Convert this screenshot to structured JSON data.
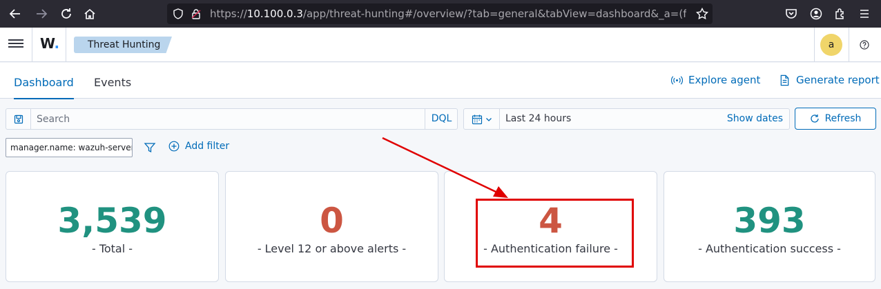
{
  "browser": {
    "url_prefix": "https://",
    "url_host": "10.100.0.3",
    "url_path": "/app/threat-hunting#/overview/?tab=general&tabView=dashboard&_a=(filters:!(),qu"
  },
  "header": {
    "logo": "W",
    "breadcrumb": "Threat Hunting",
    "avatar_letter": "a"
  },
  "tabs": {
    "items": [
      {
        "label": "Dashboard",
        "active": true
      },
      {
        "label": "Events",
        "active": false
      }
    ],
    "explore_agent": "Explore agent",
    "generate_report": "Generate report"
  },
  "search": {
    "placeholder": "Search",
    "language": "DQL"
  },
  "date": {
    "range": "Last 24 hours",
    "show_dates": "Show dates",
    "refresh": "Refresh"
  },
  "filters": {
    "pill": "manager.name: wazuh-server",
    "add_filter": "Add filter"
  },
  "metrics": [
    {
      "value": "3,539",
      "label": "- Total -",
      "color": "#209280"
    },
    {
      "value": "0",
      "label": "- Level 12 or above alerts -",
      "color": "#cc5642"
    },
    {
      "value": "4",
      "label": "- Authentication failure -",
      "color": "#cc5642"
    },
    {
      "value": "393",
      "label": "- Authentication success -",
      "color": "#209280"
    }
  ],
  "colors": {
    "link": "#006bb8",
    "annotation": "#e00000"
  }
}
